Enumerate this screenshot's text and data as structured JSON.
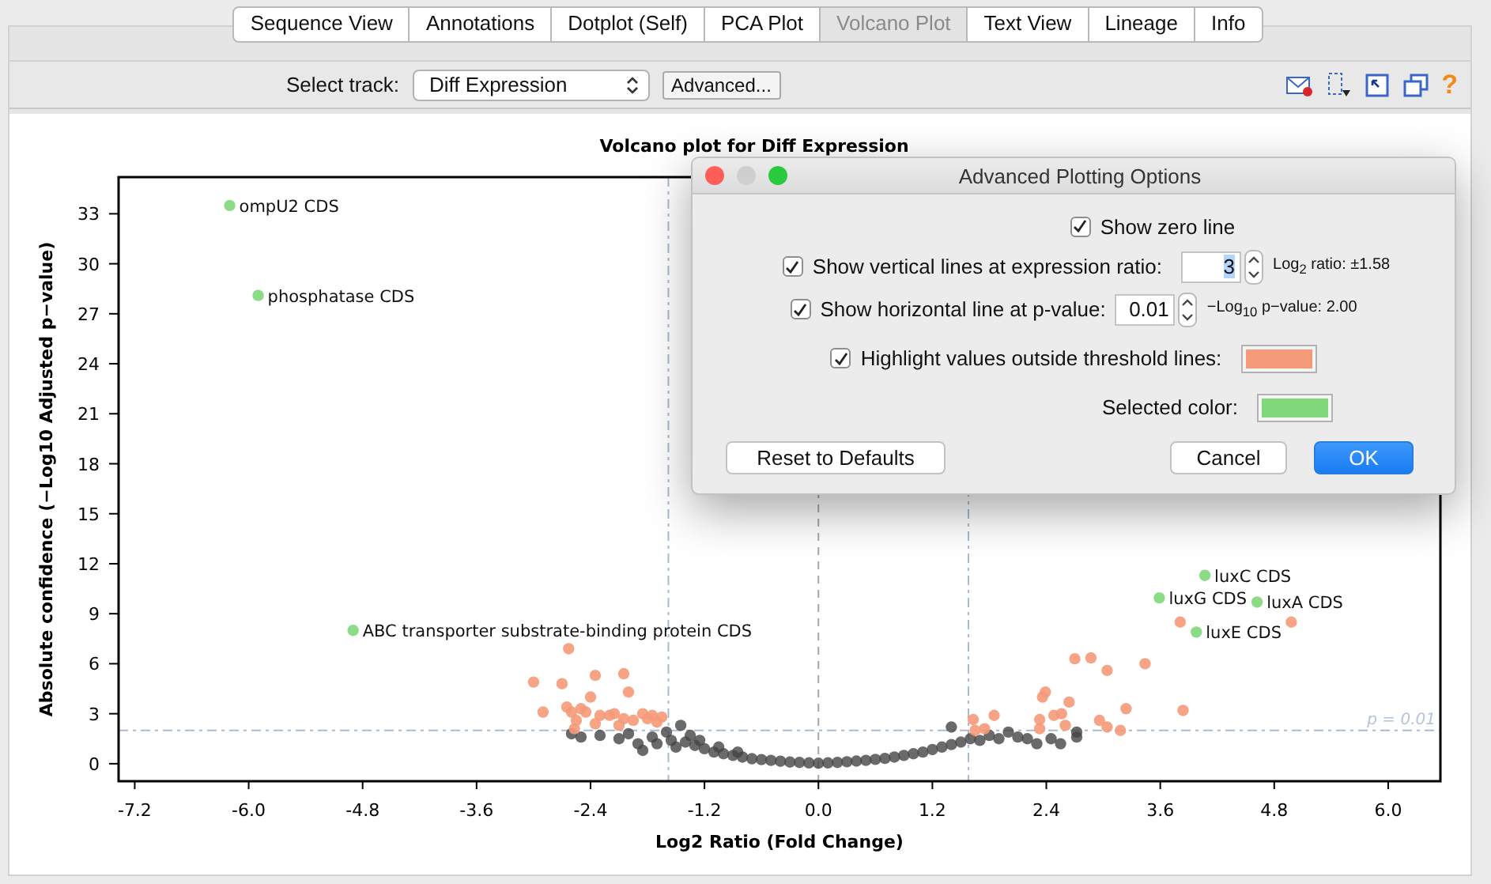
{
  "tabs": [
    {
      "label": "Sequence View",
      "selected": false
    },
    {
      "label": "Annotations",
      "selected": false
    },
    {
      "label": "Dotplot (Self)",
      "selected": false
    },
    {
      "label": "PCA Plot",
      "selected": false
    },
    {
      "label": "Volcano Plot",
      "selected": true
    },
    {
      "label": "Text View",
      "selected": false
    },
    {
      "label": "Lineage",
      "selected": false
    },
    {
      "label": "Info",
      "selected": false
    }
  ],
  "toolbar": {
    "track_label": "Select track:",
    "track_value": "Diff Expression",
    "advanced_button": "Advanced...",
    "help_glyph": "?"
  },
  "plot": {
    "chart_data": {
      "type": "scatter",
      "title": "Volcano plot for Diff Expression",
      "xlabel": "Log2 Ratio (Fold Change)",
      "ylabel": "Absolute confidence (−Log10 Adjusted p−value)",
      "xlim": [
        -7.37,
        6.55
      ],
      "ylim": [
        -1.05,
        35.2
      ],
      "xticks": [
        {
          "value": -7.2,
          "label": "-7.2"
        },
        {
          "value": -6,
          "label": "-6.0"
        },
        {
          "value": -4.8,
          "label": "-4.8"
        },
        {
          "value": -3.6,
          "label": "-3.6"
        },
        {
          "value": -2.4,
          "label": "-2.4"
        },
        {
          "value": -1.2,
          "label": "-1.2"
        },
        {
          "value": 0,
          "label": "0.0"
        },
        {
          "value": 1.2,
          "label": "1.2"
        },
        {
          "value": 2.4,
          "label": "2.4"
        },
        {
          "value": 3.6,
          "label": "3.6"
        },
        {
          "value": 4.8,
          "label": "4.8"
        },
        {
          "value": 6,
          "label": "6.0"
        }
      ],
      "yticks": [
        0,
        3,
        6,
        9,
        12,
        15,
        18,
        21,
        24,
        27,
        30,
        33
      ],
      "series": [
        {
          "color": "#454545",
          "x": [
            -2.6,
            -2.5,
            -2.3,
            -2.1,
            -2.0,
            -1.9,
            -1.85,
            -1.75,
            -1.7,
            -1.6,
            -1.55,
            -1.5,
            -1.45,
            -1.4,
            -1.35,
            -1.3,
            -1.25,
            -1.2,
            -1.1,
            -1.05,
            -1.0,
            -0.9,
            -0.85,
            -0.8,
            -0.7,
            -0.6,
            -0.5,
            -0.4,
            -0.3,
            -0.2,
            -0.1,
            0,
            0.1,
            0.2,
            0.3,
            0.4,
            0.5,
            0.6,
            0.7,
            0.8,
            0.9,
            1.0,
            1.1,
            1.2,
            1.3,
            1.4,
            1.4,
            1.5,
            1.6,
            1.7,
            1.8,
            1.9,
            2.0,
            2.1,
            2.2,
            2.3,
            2.45,
            2.55,
            2.72,
            2.72
          ],
          "values": [
            1.8,
            1.6,
            1.7,
            1.5,
            1.8,
            1.2,
            0.8,
            1.6,
            1.2,
            1.9,
            1.4,
            1.0,
            2.3,
            1.3,
            1.7,
            1.1,
            1.4,
            0.9,
            0.7,
            1.0,
            0.6,
            0.5,
            0.7,
            0.4,
            0.3,
            0.25,
            0.2,
            0.15,
            0.1,
            0.08,
            0.05,
            0.03,
            0.05,
            0.08,
            0.12,
            0.16,
            0.2,
            0.26,
            0.32,
            0.4,
            0.5,
            0.6,
            0.7,
            0.85,
            1.0,
            1.15,
            2.2,
            1.3,
            1.5,
            1.4,
            1.7,
            1.5,
            1.9,
            1.6,
            1.5,
            1.2,
            1.5,
            1.2,
            1.6,
            1.9
          ]
        },
        {
          "color": "#f59a78",
          "x": [
            -2.63,
            -3.0,
            -2.9,
            -2.7,
            -2.65,
            -2.6,
            -2.5,
            -2.45,
            -2.55,
            -2.57,
            -2.35,
            -2.4,
            -2.3,
            -2.35,
            -2.2,
            -2.15,
            -2.05,
            -2.0,
            -2.05,
            -1.95,
            -1.85,
            -1.8,
            -1.75,
            -1.7,
            -1.65,
            -2.1,
            1.63,
            1.85,
            1.65,
            1.75,
            2.33,
            2.36,
            2.39,
            2.48,
            2.56,
            2.64,
            2.7,
            2.87,
            3.04,
            2.96,
            3.04,
            3.18,
            3.24,
            3.44,
            3.84,
            3.81,
            4.98,
            2.33,
            2.6
          ],
          "values": [
            6.9,
            4.9,
            3.1,
            4.8,
            3.4,
            3.1,
            3.3,
            3.1,
            2.6,
            2.1,
            5.3,
            4.0,
            2.9,
            2.4,
            2.9,
            3.0,
            5.4,
            4.3,
            2.7,
            2.6,
            3.0,
            2.7,
            2.9,
            2.5,
            2.8,
            2.3,
            2.65,
            2.9,
            2.0,
            2.1,
            2.65,
            4.0,
            4.3,
            2.9,
            3.0,
            3.7,
            6.3,
            6.35,
            5.6,
            2.6,
            2.2,
            2.0,
            3.3,
            6.0,
            3.2,
            8.5,
            8.5,
            2.1,
            2.3
          ]
        },
        {
          "color": "#80d87a",
          "x": [
            -6.2,
            -5.9,
            -4.9,
            3.59,
            4.07,
            4.62,
            3.98
          ],
          "values": [
            33.5,
            28.1,
            8.0,
            9.95,
            11.3,
            9.7,
            7.9
          ]
        }
      ],
      "ref_lines": [
        {
          "axis": "x",
          "value": 0
        },
        {
          "axis": "x",
          "value": -1.58
        },
        {
          "axis": "x",
          "value": 1.58
        },
        {
          "axis": "y",
          "value": 2
        }
      ],
      "annotations": [
        "p = 0.01",
        {
          "x": -6.2,
          "y": 33.5,
          "text": "ompU2 CDS"
        },
        {
          "x": -5.9,
          "y": 28.1,
          "text": "phosphatase CDS"
        },
        {
          "x": -4.9,
          "y": 8.0,
          "text": "ABC transporter substrate-binding protein CDS"
        },
        {
          "x": 3.59,
          "y": 9.95,
          "text": "luxG CDS"
        },
        {
          "x": 4.62,
          "y": 9.7,
          "text": "luxA CDS"
        },
        {
          "x": 4.07,
          "y": 11.3,
          "text": "luxC CDS"
        },
        {
          "x": 3.98,
          "y": 7.9,
          "text": "luxE CDS"
        }
      ]
    }
  },
  "dialog": {
    "title": "Advanced Plotting Options",
    "options": [
      {
        "kind": "plain",
        "label": "Show zero line",
        "checked": true
      },
      {
        "kind": "spinner",
        "label": "Show vertical lines at expression ratio:",
        "checked": true,
        "value": "3",
        "note": "Log$_{2}$ ratio: ±1.58"
      },
      {
        "kind": "spinner",
        "label": "Show horizontal line at p-value:",
        "checked": true,
        "value": "0.01",
        "note": "−Log$_{10}$ p−value: 2.00"
      },
      {
        "kind": "color",
        "label": "Highlight values outside threshold lines:",
        "checked": true,
        "color": "#f59a78"
      }
    ],
    "selected_color": {
      "label": "Selected color:",
      "color": "#80d87a"
    },
    "buttons": [
      {
        "label": "Reset to Defaults",
        "default": false
      },
      {
        "label": "Cancel",
        "default": false
      },
      {
        "label": "OK",
        "default": true
      }
    ]
  }
}
